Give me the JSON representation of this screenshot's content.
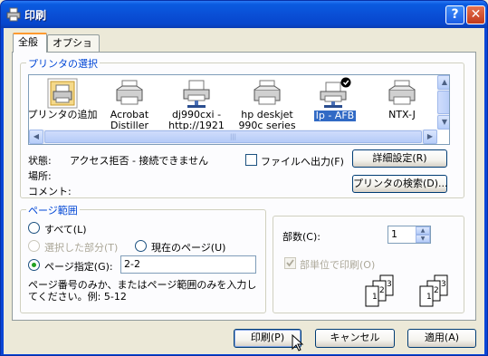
{
  "window": {
    "title": "印刷"
  },
  "tabs": [
    {
      "label": "全般"
    },
    {
      "label": "オプション"
    }
  ],
  "printer_group": {
    "title": "プリンタの選択",
    "printers": [
      {
        "line1": "プリンタの追加",
        "line2": ""
      },
      {
        "line1": "Acrobat",
        "line2": "Distiller"
      },
      {
        "line1": "dj990cxi -",
        "line2": "http://1921"
      },
      {
        "line1": "hp deskjet",
        "line2": "990c series"
      },
      {
        "line1": "lp - AFB",
        "line2": ""
      },
      {
        "line1": "NTX-J",
        "line2": ""
      }
    ]
  },
  "status": {
    "state_label": "状態:",
    "state_value": "アクセス拒否 - 接続できません",
    "location_label": "場所:",
    "comment_label": "コメント:",
    "print_to_file": "ファイルへ出力(F)",
    "preferences_button": "詳細設定(R)",
    "find_printer_button": "プリンタの検索(D)..."
  },
  "page_range": {
    "title": "ページ範囲",
    "all": "すべて(L)",
    "selection": "選択した部分(T)",
    "current_page": "現在のページ(U)",
    "pages": "ページ指定(G):",
    "pages_value": "2-2",
    "hint_line1": "ページ番号のみか、またはページ範囲のみを入力し",
    "hint_line2": "てください。例: 5-12"
  },
  "copies": {
    "label": "部数(C):",
    "value": "1",
    "collate": "部単位で印刷(O)",
    "collate_pages": [
      "1",
      "2",
      "3"
    ]
  },
  "buttons": {
    "print": "印刷(P)",
    "cancel": "キャンセル",
    "apply": "適用(A)"
  }
}
